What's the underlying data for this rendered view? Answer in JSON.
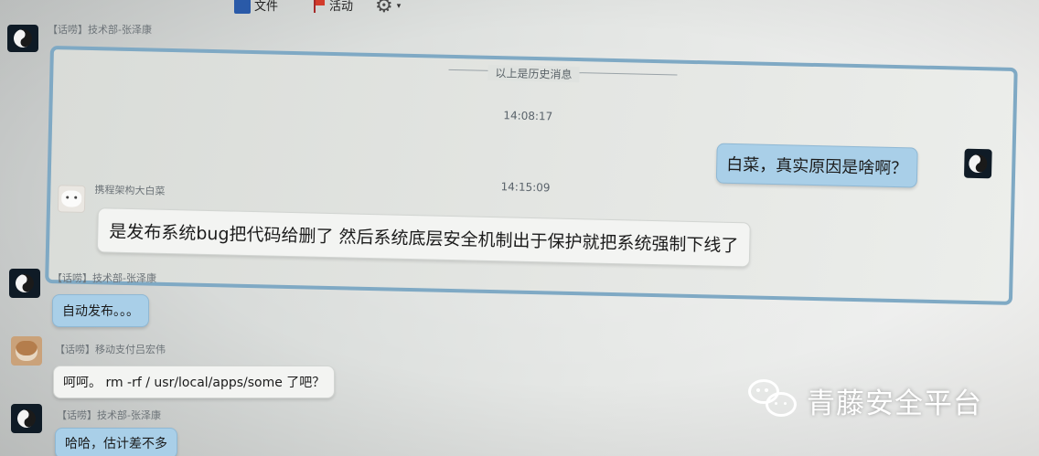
{
  "toolbar": {
    "item1_label": "",
    "item2_label": "",
    "file_label": "文件",
    "activity_label": "活动",
    "settings_caret": "▾"
  },
  "messages_top": {
    "sender1": "【话唠】技术部-张泽康"
  },
  "history": {
    "divider_label": "以上是历史消息",
    "time1": "14:08:17",
    "self_message": "白菜，真实原因是啥啊？",
    "time2": "14:15:09",
    "sender2": "携程架构大白菜",
    "reply_message": "是发布系统bug把代码给删了 然后系统底层安全机制出于保护就把系统强制下线了"
  },
  "messages": [
    {
      "sender": "【话唠】技术部-张泽康",
      "text": "自动发布。。。"
    },
    {
      "sender": "【话唠】移动支付吕宏伟",
      "text": "呵呵。 rm -rf / usr/local/apps/some 了吧？"
    },
    {
      "sender": "【话唠】技术部-张泽康",
      "text": "哈哈，估计差不多"
    }
  ],
  "watermark": {
    "text": "青藤安全平台",
    "logo_icon": "wechat-logo"
  },
  "colors": {
    "self_bubble": "#a9cfe8",
    "other_bubble": "#f3f4f2",
    "history_border": "#7fa9c4"
  }
}
